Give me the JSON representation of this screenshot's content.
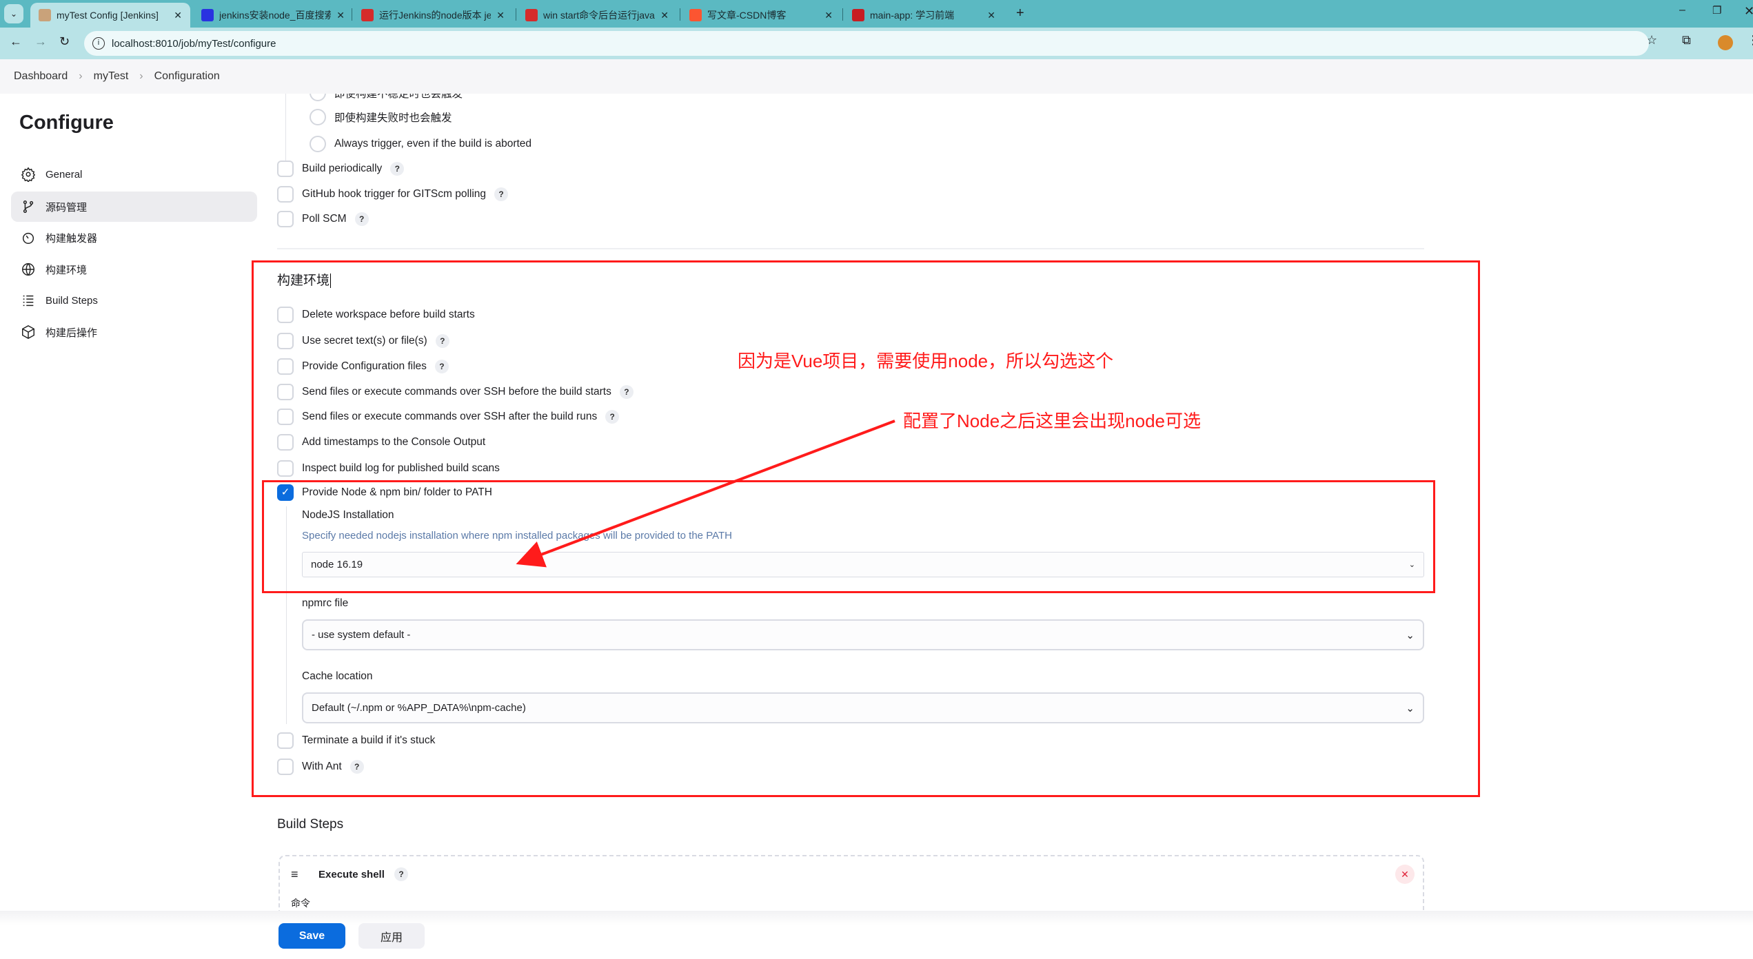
{
  "browser": {
    "tabs": [
      {
        "title": "myTest Config [Jenkins]",
        "active": true,
        "icon": "jenkins-icon",
        "color": "#c9a27a"
      },
      {
        "title": "jenkins安装node_百度搜索",
        "icon": "baidu-icon",
        "color": "#2932e1"
      },
      {
        "title": "运行Jenkins的node版本 jenkins",
        "icon": "51cto-icon",
        "color": "#d52b2b"
      },
      {
        "title": "win start命令后台运行java程序",
        "icon": "51cto-icon",
        "color": "#d52b2b"
      },
      {
        "title": "写文章-CSDN博客",
        "icon": "csdn-icon",
        "color": "#fc5531"
      },
      {
        "title": "main-app: 学习前端",
        "icon": "gitee-icon",
        "color": "#c71d23"
      }
    ],
    "url": "localhost:8010/job/myTest/configure"
  },
  "breadcrumb": [
    "Dashboard",
    "myTest",
    "Configuration"
  ],
  "sidebar": {
    "title": "Configure",
    "items": [
      {
        "label": "General",
        "icon": "gear-icon"
      },
      {
        "label": "源码管理",
        "icon": "branch-icon",
        "active": true
      },
      {
        "label": "构建触发器",
        "icon": "timer-icon"
      },
      {
        "label": "构建环境",
        "icon": "globe-icon"
      },
      {
        "label": "Build Steps",
        "icon": "list-icon"
      },
      {
        "label": "构建后操作",
        "icon": "package-icon"
      }
    ]
  },
  "triggers": {
    "radios": [
      "即使构建不稳定时也会触发",
      "即使构建失败时也会触发",
      "Always trigger, even if the build is aborted"
    ],
    "checkboxes": [
      "Build periodically",
      "GitHub hook trigger for GITScm polling",
      "Poll SCM"
    ]
  },
  "env": {
    "heading": "构建环境",
    "options": [
      "Delete workspace before build starts",
      "Use secret text(s) or file(s)",
      "Provide Configuration files",
      "Send files or execute commands over SSH before the build starts",
      "Send files or execute commands over SSH after the build runs",
      "Add timestamps to the Console Output",
      "Inspect build log for published build scans"
    ],
    "node_option": "Provide Node & npm bin/ folder to PATH",
    "node_label": "NodeJS Installation",
    "node_desc": "Specify needed nodejs installation where npm installed packages will be provided to the PATH",
    "node_value": "node 16.19",
    "npmrc_label": "npmrc file",
    "npmrc_value": "- use system default -",
    "cache_label": "Cache location",
    "cache_value": "Default (~/.npm or %APP_DATA%\\npm-cache)",
    "terminate": "Terminate a build if it's stuck",
    "ant": "With Ant"
  },
  "build_steps": {
    "heading": "Build Steps",
    "step_title": "Execute shell",
    "command_label": "命令"
  },
  "actions": {
    "save": "Save",
    "apply": "应用"
  },
  "annotations": {
    "note1": "因为是Vue项目，需要使用node，所以勾选这个",
    "note2": "配置了Node之后这里会出现node可选",
    "color": "#ff1b1b"
  },
  "help_mark": "?",
  "check_mark": "✓"
}
